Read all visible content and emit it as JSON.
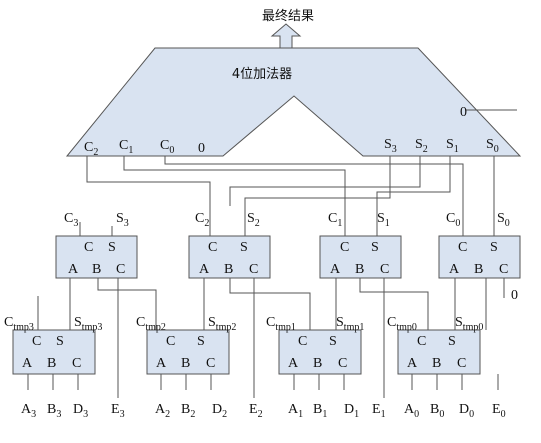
{
  "result_label": "最终结果",
  "adder": {
    "title": "4位加法器",
    "input_zero": "0",
    "carry_in_zero": "0",
    "carry_ports": [
      {
        "base": "C",
        "sub": "2"
      },
      {
        "base": "C",
        "sub": "1"
      },
      {
        "base": "C",
        "sub": "0"
      }
    ],
    "sum_ports": [
      {
        "base": "S",
        "sub": "3"
      },
      {
        "base": "S",
        "sub": "2"
      },
      {
        "base": "S",
        "sub": "1"
      },
      {
        "base": "S",
        "sub": "0"
      }
    ]
  },
  "top_adders": [
    {
      "c_out": {
        "base": "C",
        "sub": "3"
      },
      "s_out": {
        "base": "S",
        "sub": "3"
      }
    },
    {
      "c_out": {
        "base": "C",
        "sub": "2"
      },
      "s_out": {
        "base": "S",
        "sub": "2"
      }
    },
    {
      "c_out": {
        "base": "C",
        "sub": "1"
      },
      "s_out": {
        "base": "S",
        "sub": "1"
      }
    },
    {
      "c_out": {
        "base": "C",
        "sub": "0"
      },
      "s_out": {
        "base": "S",
        "sub": "0"
      }
    }
  ],
  "bottom_adders": [
    {
      "c_out": {
        "base": "C",
        "sub": "tmp3"
      },
      "s_out": {
        "base": "S",
        "sub": "tmp3"
      }
    },
    {
      "c_out": {
        "base": "C",
        "sub": "tmp2"
      },
      "s_out": {
        "base": "S",
        "sub": "tmp2"
      }
    },
    {
      "c_out": {
        "base": "C",
        "sub": "tmp1"
      },
      "s_out": {
        "base": "S",
        "sub": "tmp1"
      }
    },
    {
      "c_out": {
        "base": "C",
        "sub": "tmp0"
      },
      "s_out": {
        "base": "S",
        "sub": "tmp0"
      }
    }
  ],
  "adder_ports": {
    "c": "C",
    "s": "S",
    "a": "A",
    "b": "B",
    "cin": "C"
  },
  "last_cin_zero": "0",
  "inputs": [
    {
      "base": "A",
      "sub": "3"
    },
    {
      "base": "B",
      "sub": "3"
    },
    {
      "base": "D",
      "sub": "3"
    },
    {
      "base": "E",
      "sub": "3"
    },
    {
      "base": "A",
      "sub": "2"
    },
    {
      "base": "B",
      "sub": "2"
    },
    {
      "base": "D",
      "sub": "2"
    },
    {
      "base": "E",
      "sub": "2"
    },
    {
      "base": "A",
      "sub": "1"
    },
    {
      "base": "B",
      "sub": "1"
    },
    {
      "base": "D",
      "sub": "1"
    },
    {
      "base": "E",
      "sub": "1"
    },
    {
      "base": "A",
      "sub": "0"
    },
    {
      "base": "B",
      "sub": "0"
    },
    {
      "base": "D",
      "sub": "0"
    },
    {
      "base": "E",
      "sub": "0"
    }
  ]
}
